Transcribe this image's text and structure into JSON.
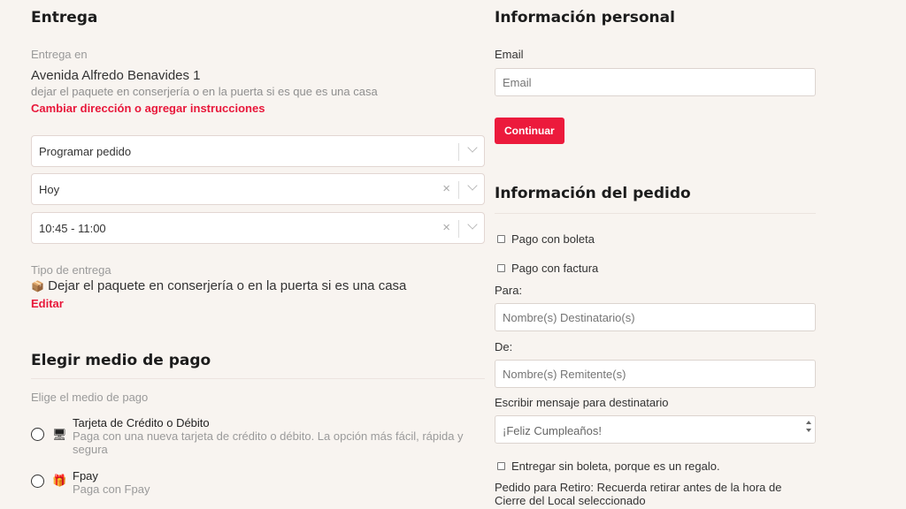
{
  "entrega": {
    "title": "Entrega",
    "delivery_to_label": "Entrega en",
    "address": "Avenida Alfredo Benavides 1",
    "address_note": "dejar el paquete en conserjería o en la puerta si es que es una casa",
    "change_link": "Cambiar dirección o agregar instrucciones",
    "schedule_select": "Programar pedido",
    "day_select": "Hoy",
    "time_select": "10:45 - 11:00",
    "delivery_type_label": "Tipo de entrega",
    "delivery_type_icon": "📦",
    "delivery_type_value": "Dejar el paquete en conserjería o en la puerta si es una casa",
    "edit_link": "Editar"
  },
  "payment": {
    "title": "Elegir medio de pago",
    "subtitle": "Elige el medio de pago",
    "options": [
      {
        "icon": "card-icon",
        "glyph": "🖥",
        "title": "Tarjeta de Crédito o Débito",
        "desc": "Paga con una nueva tarjeta de crédito o débito. La opción más fácil, rápida y segura"
      },
      {
        "icon": "wallet-icon",
        "glyph": "🎁",
        "title": "Fpay",
        "desc": "Paga con Fpay"
      }
    ]
  },
  "personal": {
    "title": "Información personal",
    "email_label": "Email",
    "email_placeholder": "Email",
    "continue_button": "Continuar"
  },
  "order": {
    "title": "Información del pedido",
    "boleta_label": "Pago con boleta",
    "factura_label": "Pago con factura",
    "para_label": "Para:",
    "para_placeholder": "Nombre(s) Destinatario(s)",
    "de_label": "De:",
    "de_placeholder": "Nombre(s) Remitente(s)",
    "message_label": "Escribir mensaje para destinatario",
    "message_value": "¡Feliz Cumpleaños!",
    "gift_label": "Entregar sin boleta, porque es un regalo.",
    "pickup_note": "Pedido para Retiro: Recuerda retirar antes de la hora de Cierre del Local seleccionado"
  },
  "colors": {
    "accent": "#ec1a3c",
    "background": "#f8f4f0"
  }
}
